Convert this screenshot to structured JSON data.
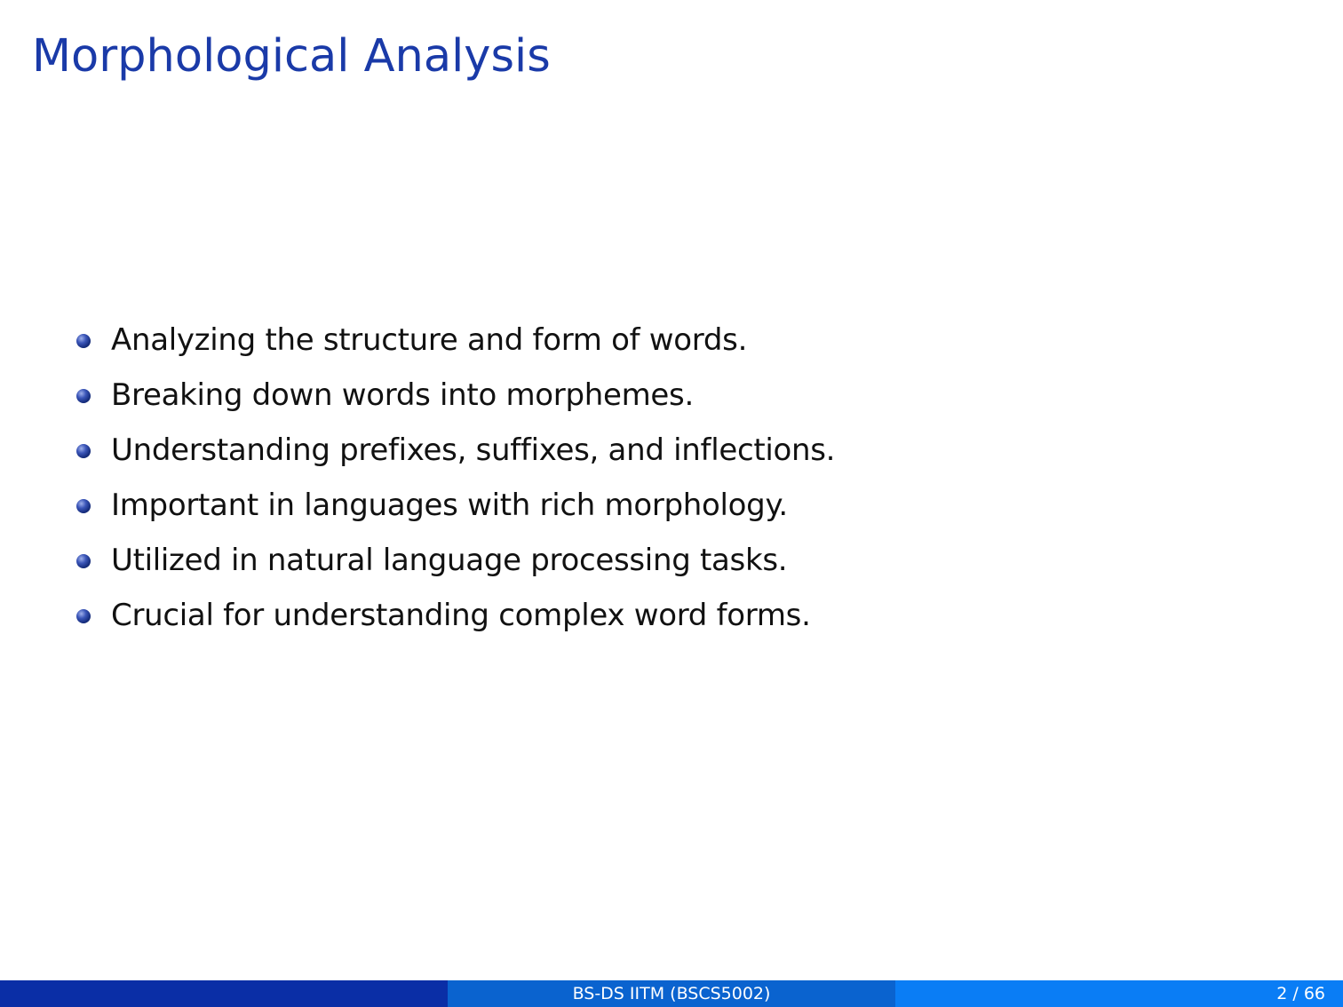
{
  "slide": {
    "title": "Morphological Analysis",
    "bullets": [
      "Analyzing the structure and form of words.",
      "Breaking down words into morphemes.",
      "Understanding prefixes, suffixes, and inflections.",
      "Important in languages with rich morphology.",
      "Utilized in natural language processing tasks.",
      "Crucial for understanding complex word forms."
    ]
  },
  "footer": {
    "center_text": "BS-DS IITM (BSCS5002)",
    "page_number": "2 / 66"
  },
  "colors": {
    "title": "#1a3aa8",
    "footer_left": "#0a2ea6",
    "footer_center": "#0a63cf",
    "footer_right": "#0a7df5"
  }
}
